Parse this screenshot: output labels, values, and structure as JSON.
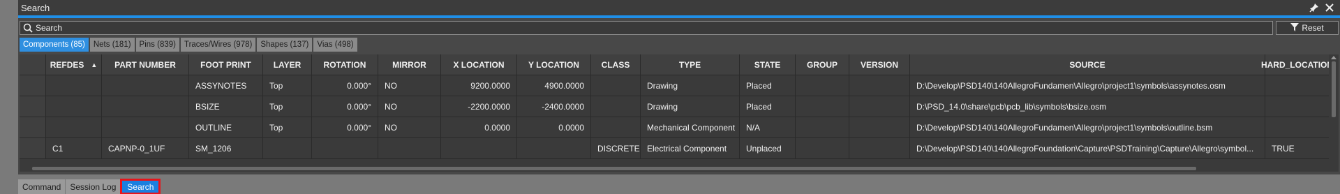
{
  "window": {
    "title": "Search"
  },
  "search": {
    "placeholder": "Search",
    "value": ""
  },
  "reset": {
    "label": "Reset"
  },
  "tabs": [
    {
      "label": "Components (85)",
      "active": true
    },
    {
      "label": "Nets (181)"
    },
    {
      "label": "Pins (839)"
    },
    {
      "label": "Traces/Wires (978)"
    },
    {
      "label": "Shapes (137)"
    },
    {
      "label": "Vias (498)"
    }
  ],
  "table": {
    "columns": [
      "",
      "REFDES",
      "PART NUMBER",
      "FOOT PRINT",
      "LAYER",
      "ROTATION",
      "MIRROR",
      "X LOCATION",
      "Y LOCATION",
      "CLASS",
      "TYPE",
      "STATE",
      "GROUP",
      "VERSION",
      "SOURCE",
      "HARD_LOCATION"
    ],
    "sort_indicator": "▲",
    "rows": [
      [
        "",
        "",
        "",
        "ASSYNOTES",
        "Top",
        "0.000°",
        "NO",
        "9200.0000",
        "4900.0000",
        "",
        "Drawing",
        "Placed",
        "",
        "",
        "D:\\Develop\\PSD140\\140AllegroFundamen\\Allegro\\project1\\symbols\\assynotes.osm",
        ""
      ],
      [
        "",
        "",
        "",
        "BSIZE",
        "Top",
        "0.000°",
        "NO",
        "-2200.0000",
        "-2400.0000",
        "",
        "Drawing",
        "Placed",
        "",
        "",
        "D:\\PSD_14.0\\share\\pcb\\pcb_lib\\symbols\\bsize.osm",
        ""
      ],
      [
        "",
        "",
        "",
        "OUTLINE",
        "Top",
        "0.000°",
        "NO",
        "0.0000",
        "0.0000",
        "",
        "Mechanical Component",
        "N/A",
        "",
        "",
        "D:\\Develop\\PSD140\\140AllegroFundamen\\Allegro\\project1\\symbols\\outline.bsm",
        ""
      ],
      [
        "",
        "C1",
        "CAPNP-0_1UF",
        "SM_1206",
        "",
        "",
        "",
        "",
        "",
        "DISCRETE",
        "Electrical Component",
        "Unplaced",
        "",
        "",
        "D:\\Develop\\PSD140\\140AllegroFoundation\\Capture\\PSDTraining\\Capture\\Allegro\\symbol...",
        "TRUE"
      ]
    ]
  },
  "bottom_tabs": [
    {
      "label": "Command"
    },
    {
      "label": "Session Log"
    },
    {
      "label": "Search",
      "active": true
    }
  ],
  "icons": {
    "search": "search-icon",
    "filter": "filter-icon",
    "pin": "pin-icon",
    "close": "close-icon"
  },
  "colors": {
    "accent": "#1f8fe8",
    "active_tab": "#2f8fe0",
    "highlight": "#e8141a"
  }
}
